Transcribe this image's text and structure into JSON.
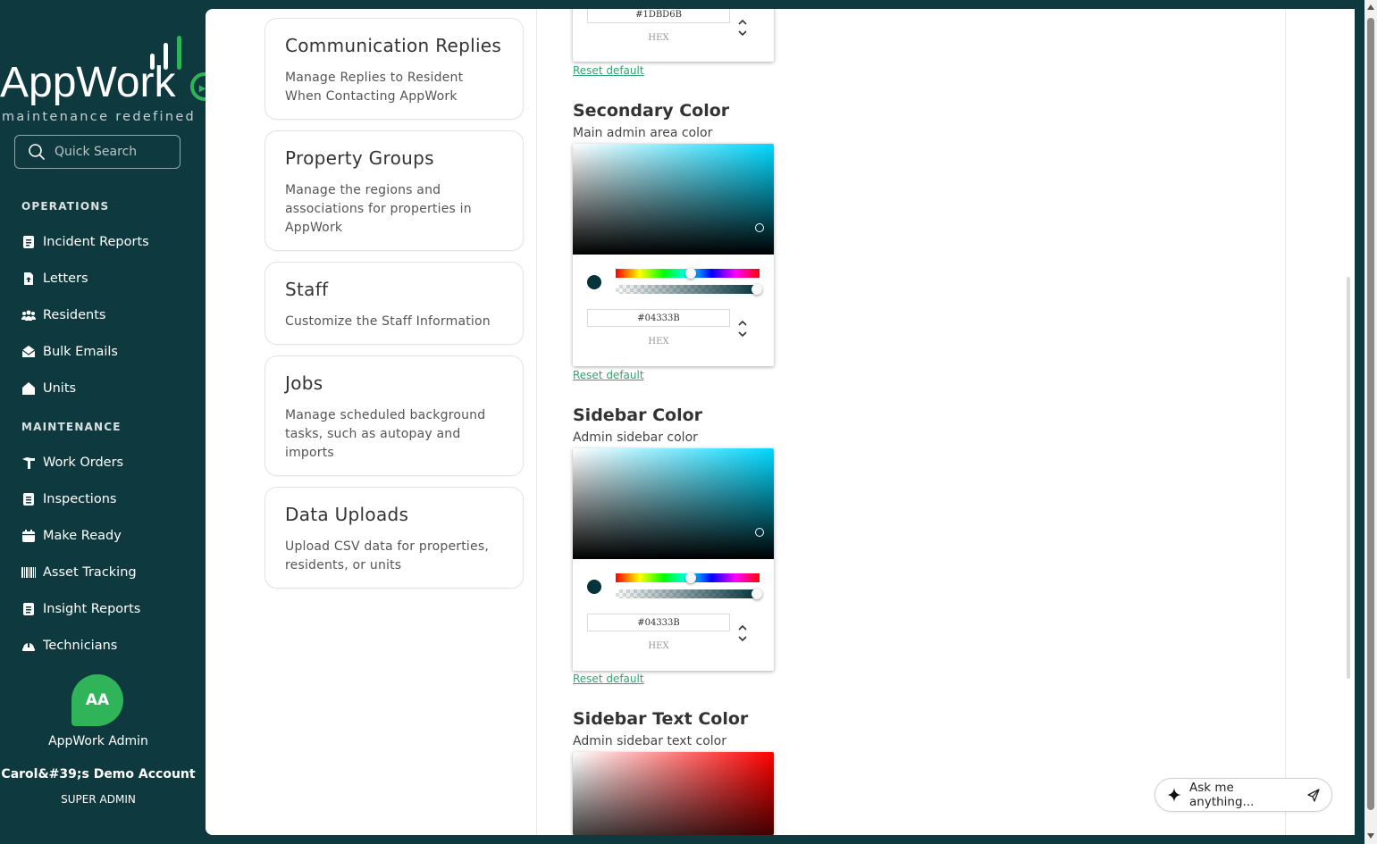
{
  "sidebar": {
    "logo_text": "AppWork",
    "logo_tagline": "maintenance redefined",
    "search_placeholder": "Quick Search",
    "sections": [
      {
        "label": "OPERATIONS"
      },
      {
        "label": "MAINTENANCE"
      }
    ],
    "items": [
      {
        "label": "Incident Reports",
        "icon": "document-icon"
      },
      {
        "label": "Letters",
        "icon": "letter-icon"
      },
      {
        "label": "Residents",
        "icon": "people-icon"
      },
      {
        "label": "Bulk Emails",
        "icon": "envelope-icon"
      },
      {
        "label": "Units",
        "icon": "home-icon"
      },
      {
        "label": "Work Orders",
        "icon": "hammer-icon"
      },
      {
        "label": "Inspections",
        "icon": "clipboard-icon"
      },
      {
        "label": "Make Ready",
        "icon": "calendar-icon"
      },
      {
        "label": "Asset Tracking",
        "icon": "barcode-icon"
      },
      {
        "label": "Insight Reports",
        "icon": "report-icon"
      },
      {
        "label": "Technicians",
        "icon": "helmet-icon"
      }
    ],
    "user": {
      "initials": "AA",
      "name": "AppWork Admin",
      "account": "Carol&#39;s Demo Account",
      "role": "SUPER ADMIN"
    }
  },
  "cards": [
    {
      "title": "Communication Replies",
      "description": "Manage Replies to Resident When Contacting AppWork"
    },
    {
      "title": "Property Groups",
      "description": "Manage the regions and associations for properties in AppWork"
    },
    {
      "title": "Staff",
      "description": "Customize the Staff Information"
    },
    {
      "title": "Jobs",
      "description": "Manage scheduled background tasks, such as autopay and imports"
    },
    {
      "title": "Data Uploads",
      "description": "Upload CSV data for properties, residents, or units"
    }
  ],
  "color_settings": {
    "top_picker": {
      "hex": "#1DBD6B",
      "hex_label": "HEX",
      "reset": "Reset default"
    },
    "secondary": {
      "title": "Secondary Color",
      "subtitle": "Main admin area color",
      "hex": "#04333B",
      "hex_label": "HEX",
      "reset": "Reset default",
      "hue_color": "#00d8ff"
    },
    "sidebar": {
      "title": "Sidebar Color",
      "subtitle": "Admin sidebar color",
      "hex": "#04333B",
      "hex_label": "HEX",
      "reset": "Reset default",
      "hue_color": "#00d8ff"
    },
    "sidebar_text": {
      "title": "Sidebar Text Color",
      "subtitle": "Admin sidebar text color",
      "hue_color": "#ff0000"
    }
  },
  "assistant": {
    "placeholder": "Ask me anything..."
  },
  "colors": {
    "sidebar_bg": "#0e3a3f",
    "accent_green": "#2fb45a",
    "link_green": "#2fa56f"
  }
}
